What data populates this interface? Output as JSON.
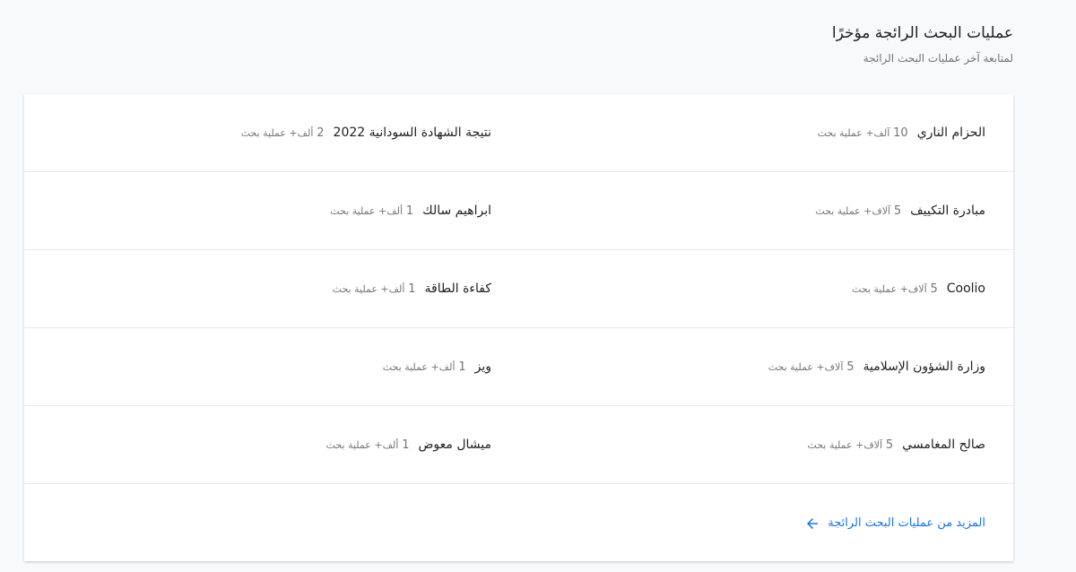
{
  "header": {
    "title": "عمليات البحث الرائجة مؤخرًا",
    "subtitle": "لمتابعة آخر عمليات البحث الرائجة"
  },
  "rows": [
    {
      "right": {
        "term": "الحزام الناري",
        "num": "10",
        "unit": "آلف+ عملية بحث"
      },
      "left": {
        "term": "نتيجة الشهادة السودانية 2022",
        "num": "2",
        "unit": "ألف+ عملية بحث"
      }
    },
    {
      "right": {
        "term": "مبادرة التكييف",
        "num": "5",
        "unit": "آلاف+ عملية بحث"
      },
      "left": {
        "term": "ابراهيم سالك",
        "num": "1",
        "unit": "ألف+ عملية بحث"
      }
    },
    {
      "right": {
        "term": "Coolio",
        "num": "5",
        "unit": "آلاف+ عملية بحث"
      },
      "left": {
        "term": "كفاءة الطاقة",
        "num": "1",
        "unit": "ألف+ عملية بحث"
      }
    },
    {
      "right": {
        "term": "وزارة الشؤون الإسلامية",
        "num": "5",
        "unit": "آلاف+ عملية بحث"
      },
      "left": {
        "term": "ويز",
        "num": "1",
        "unit": "ألف+ عملية بحث"
      }
    },
    {
      "right": {
        "term": "صالح المغامسي",
        "num": "5",
        "unit": "آلاف+ عملية بحث"
      },
      "left": {
        "term": "ميشال معوض",
        "num": "1",
        "unit": "ألف+ عملية بحث"
      }
    }
  ],
  "more_link": {
    "label": "المزيد من عمليات البحث الرائجة",
    "icon": "arrow-left-icon",
    "color": "#1a73e8"
  }
}
